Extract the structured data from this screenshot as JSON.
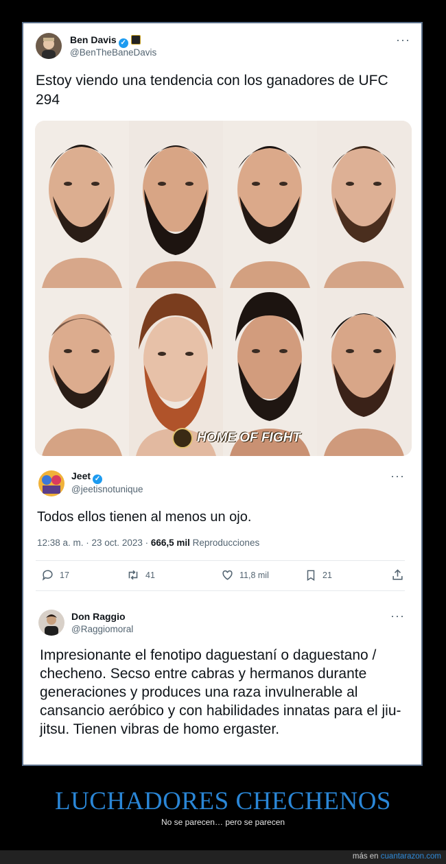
{
  "tweet1": {
    "name": "Ben Davis",
    "handle": "@BenTheBaneDavis",
    "text": "Estoy viendo una tendencia con los ganadores de UFC 294",
    "media": {
      "watermark": "HOME OF FIGHT"
    }
  },
  "tweet2": {
    "name": "Jeet",
    "handle": "@jeetisnotunique",
    "text": "Todos ellos tienen al menos un ojo.",
    "timestamp": "12:38 a. m. · 23 oct. 2023 · ",
    "views_count": "666,5 mil",
    "views_label": " Reproducciones",
    "actions": {
      "replies": "17",
      "retweets": "41",
      "likes": "11,8 mil",
      "bookmarks": "21"
    }
  },
  "tweet3": {
    "name": "Don Raggio",
    "handle": "@Raggiomoral",
    "text": "Impresionante el fenotipo daguestaní o daguestano / checheno. Secso entre cabras y hermanos durante generaciones y produces una raza invulnerable al cansancio aeróbico y con habilidades innatas para el jiu-jitsu. Tienen vibras de homo ergaster."
  },
  "more_glyph": "···",
  "verified_glyph": "✓",
  "title": "LUCHADORES CHECHENOS",
  "subtitle": "No se parecen… pero se parecen",
  "footer": {
    "prefix": "más en ",
    "site": "cuantarazon.com"
  },
  "colors": {
    "accent": "#2a86d6",
    "verified": "#1d9bf0",
    "text": "#0f1419",
    "muted": "#536471"
  }
}
